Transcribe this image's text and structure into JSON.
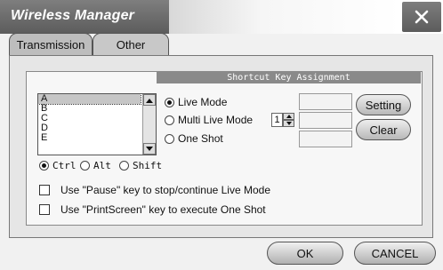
{
  "window": {
    "title": "Wireless Manager",
    "close_icon": "close-icon"
  },
  "tabs": [
    {
      "label": "Transmission",
      "selected": false
    },
    {
      "label": "Other",
      "selected": true
    }
  ],
  "shortcut_panel": {
    "header": "Shortcut Key Assignment",
    "list": {
      "items": [
        "A",
        "B",
        "C",
        "D",
        "E"
      ],
      "selected": "A"
    },
    "modifiers": [
      {
        "label": "Ctrl",
        "selected": true
      },
      {
        "label": "Alt",
        "selected": false
      },
      {
        "label": "Shift",
        "selected": false
      }
    ],
    "modes": [
      {
        "label": "Live Mode",
        "selected": true
      },
      {
        "label": "Multi Live Mode",
        "selected": false
      },
      {
        "label": "One Shot",
        "selected": false
      }
    ],
    "multi_live_value": "1",
    "setting_label": "Setting",
    "clear_label": "Clear"
  },
  "options": [
    {
      "label": "Use \"Pause\" key to stop/continue Live Mode",
      "checked": false
    },
    {
      "label": "Use \"PrintScreen\" key to execute One Shot",
      "checked": false
    }
  ],
  "footer": {
    "ok_label": "OK",
    "cancel_label": "CANCEL"
  }
}
